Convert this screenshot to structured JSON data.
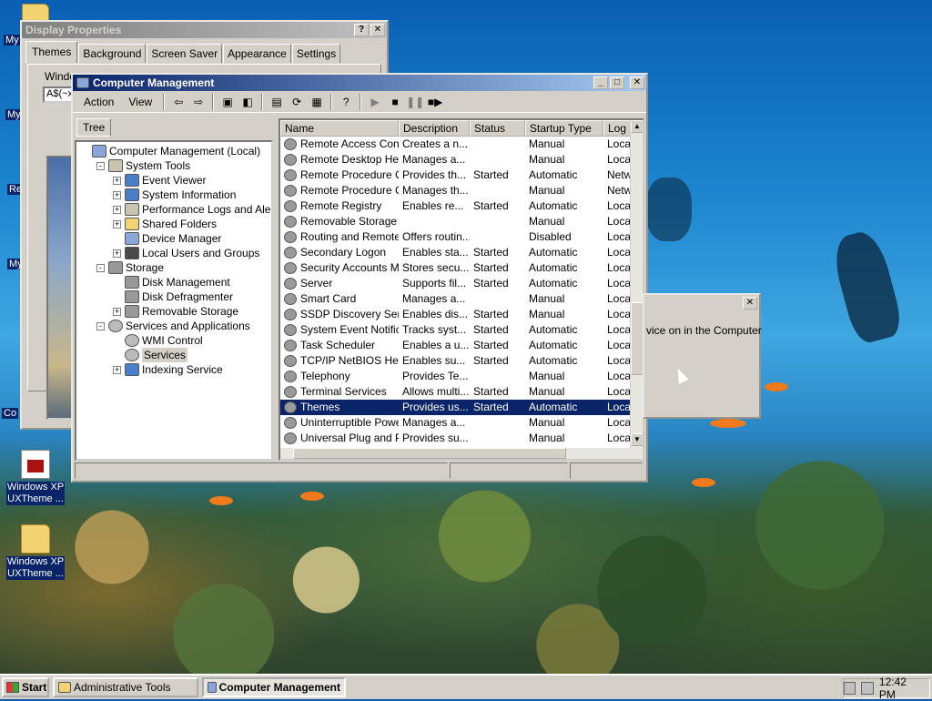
{
  "desktop": {
    "icons": [
      {
        "label1": "Windows XP",
        "label2": "UXTheme ...",
        "icon": "document-icon"
      },
      {
        "label1": "Windows XP",
        "label2": "UXTheme ...",
        "icon": "folder-icon"
      }
    ],
    "partial_labels": [
      "My",
      "My",
      "Re",
      "My",
      "Co"
    ]
  },
  "display_properties": {
    "title": "Display Properties",
    "tabs": [
      "Themes",
      "Background",
      "Screen Saver",
      "Appearance",
      "Settings"
    ],
    "selected_tab": "Themes",
    "partial_label": "Windo",
    "partial_input": "A$(~x"
  },
  "computer_management": {
    "title": "Computer Management",
    "menu": {
      "action": "Action",
      "view": "View"
    },
    "tree_tab": "Tree",
    "tree": [
      {
        "label": "Computer Management (Local)",
        "depth": 0,
        "exp": "",
        "icon": "comp"
      },
      {
        "label": "System Tools",
        "depth": 1,
        "exp": "-",
        "icon": "tool"
      },
      {
        "label": "Event Viewer",
        "depth": 2,
        "exp": "+",
        "icon": "info"
      },
      {
        "label": "System Information",
        "depth": 2,
        "exp": "+",
        "icon": "info"
      },
      {
        "label": "Performance Logs and Alerts",
        "depth": 2,
        "exp": "+",
        "icon": "tool"
      },
      {
        "label": "Shared Folders",
        "depth": 2,
        "exp": "+",
        "icon": "fold"
      },
      {
        "label": "Device Manager",
        "depth": 2,
        "exp": "",
        "icon": "comp"
      },
      {
        "label": "Local Users and Groups",
        "depth": 2,
        "exp": "+",
        "icon": "user"
      },
      {
        "label": "Storage",
        "depth": 1,
        "exp": "-",
        "icon": "disk"
      },
      {
        "label": "Disk Management",
        "depth": 2,
        "exp": "",
        "icon": "disk"
      },
      {
        "label": "Disk Defragmenter",
        "depth": 2,
        "exp": "",
        "icon": "disk"
      },
      {
        "label": "Removable Storage",
        "depth": 2,
        "exp": "+",
        "icon": "disk"
      },
      {
        "label": "Services and Applications",
        "depth": 1,
        "exp": "-",
        "icon": "gear"
      },
      {
        "label": "WMI Control",
        "depth": 2,
        "exp": "",
        "icon": "gear"
      },
      {
        "label": "Services",
        "depth": 2,
        "exp": "",
        "icon": "gear",
        "selected": true
      },
      {
        "label": "Indexing Service",
        "depth": 2,
        "exp": "+",
        "icon": "info"
      }
    ],
    "columns": [
      "Name",
      "Description",
      "Status",
      "Startup Type",
      "Log O"
    ],
    "services": [
      {
        "name": "Remote Access Con...",
        "description": "Creates a n...",
        "status": "",
        "startup": "Manual",
        "logon": "Local"
      },
      {
        "name": "Remote Desktop Hel...",
        "description": "Manages a...",
        "status": "",
        "startup": "Manual",
        "logon": "Local"
      },
      {
        "name": "Remote Procedure C...",
        "description": "Provides th...",
        "status": "Started",
        "startup": "Automatic",
        "logon": "Netwo"
      },
      {
        "name": "Remote Procedure C...",
        "description": "Manages th...",
        "status": "",
        "startup": "Manual",
        "logon": "Netwo"
      },
      {
        "name": "Remote Registry",
        "description": "Enables re...",
        "status": "Started",
        "startup": "Automatic",
        "logon": "Local"
      },
      {
        "name": "Removable Storage",
        "description": "",
        "status": "",
        "startup": "Manual",
        "logon": "Local"
      },
      {
        "name": "Routing and Remote...",
        "description": "Offers routin...",
        "status": "",
        "startup": "Disabled",
        "logon": "Local"
      },
      {
        "name": "Secondary Logon",
        "description": "Enables sta...",
        "status": "Started",
        "startup": "Automatic",
        "logon": "Local"
      },
      {
        "name": "Security Accounts M...",
        "description": "Stores secu...",
        "status": "Started",
        "startup": "Automatic",
        "logon": "Local"
      },
      {
        "name": "Server",
        "description": "Supports fil...",
        "status": "Started",
        "startup": "Automatic",
        "logon": "Local"
      },
      {
        "name": "Smart Card",
        "description": "Manages a...",
        "status": "",
        "startup": "Manual",
        "logon": "Local"
      },
      {
        "name": "SSDP Discovery Ser...",
        "description": "Enables dis...",
        "status": "Started",
        "startup": "Manual",
        "logon": "Local"
      },
      {
        "name": "System Event Notific...",
        "description": "Tracks syst...",
        "status": "Started",
        "startup": "Automatic",
        "logon": "Local"
      },
      {
        "name": "Task Scheduler",
        "description": "Enables a u...",
        "status": "Started",
        "startup": "Automatic",
        "logon": "Local"
      },
      {
        "name": "TCP/IP NetBIOS He...",
        "description": "Enables su...",
        "status": "Started",
        "startup": "Automatic",
        "logon": "Local"
      },
      {
        "name": "Telephony",
        "description": "Provides Te...",
        "status": "",
        "startup": "Manual",
        "logon": "Local"
      },
      {
        "name": "Terminal Services",
        "description": "Allows multi...",
        "status": "Started",
        "startup": "Manual",
        "logon": "Local"
      },
      {
        "name": "Themes",
        "description": "Provides us...",
        "status": "Started",
        "startup": "Automatic",
        "logon": "Local",
        "selected": true
      },
      {
        "name": "Uninterruptible Powe...",
        "description": "Manages a...",
        "status": "",
        "startup": "Manual",
        "logon": "Local"
      },
      {
        "name": "Universal Plug and P...",
        "description": "Provides su...",
        "status": "",
        "startup": "Manual",
        "logon": "Local"
      }
    ]
  },
  "small_dialog": {
    "text": "vice on in the Computer"
  },
  "taskbar": {
    "start": "Start",
    "items": [
      {
        "label": "Administrative Tools",
        "active": false
      },
      {
        "label": "Computer Management",
        "active": true
      }
    ],
    "clock": "12:42 PM"
  },
  "colors": {
    "selection": "#0a246a",
    "title_active": "#0a246a",
    "face": "#d4d0c8"
  }
}
